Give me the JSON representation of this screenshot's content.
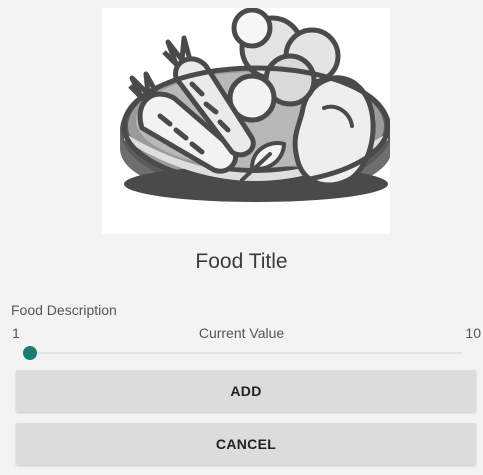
{
  "food": {
    "title": "Food Title",
    "description": "Food Description",
    "image_icon": "food-bowl-icon"
  },
  "slider": {
    "min_label": "1",
    "current_label": "Current Value",
    "max_label": "10",
    "min": 1,
    "max": 10,
    "value": 1,
    "accent_color": "#1b7f6c"
  },
  "buttons": {
    "add_label": "ADD",
    "cancel_label": "CANCEL"
  }
}
